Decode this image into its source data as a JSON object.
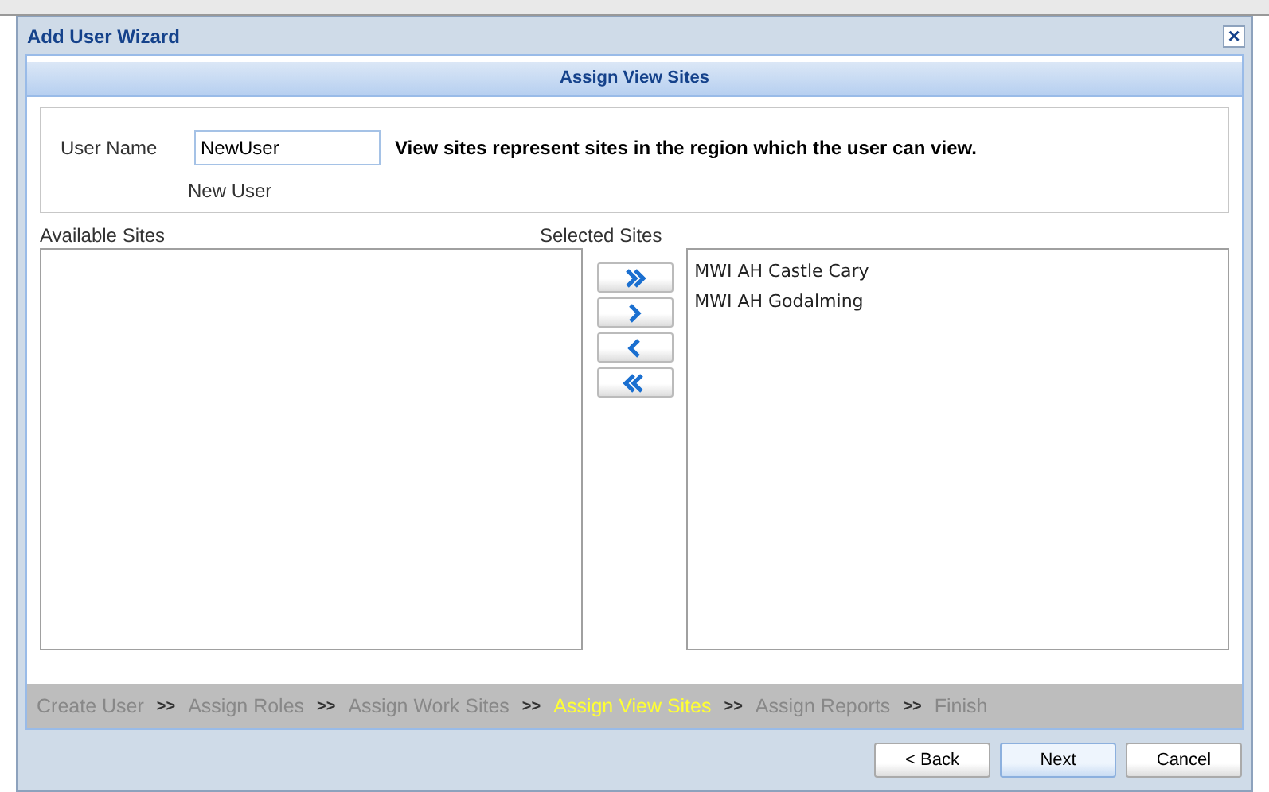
{
  "window": {
    "title": "Add User Wizard",
    "close": "×"
  },
  "header": "Assign View Sites",
  "user": {
    "label": "User Name",
    "value": "NewUser",
    "hint": "View sites represent sites in the region which the user can view.",
    "display_name": "New User"
  },
  "available": {
    "label": "Available Sites"
  },
  "selected_sites": {
    "label": "Selected Sites",
    "items": [
      "MWI AH Castle Cary",
      "MWI AH Godalming"
    ]
  },
  "steps": [
    {
      "label": "Create User",
      "selected": false,
      "separator": ">>"
    },
    {
      "label": "Assign Roles",
      "selected": false,
      "separator": ">>"
    },
    {
      "label": "Assign Work Sites",
      "selected": false,
      "separator": ">>"
    },
    {
      "label": "Assign View Sites",
      "selected": true,
      "separator": ">>"
    },
    {
      "label": "Assign Reports",
      "selected": false,
      "separator": ">>"
    },
    {
      "label": "Finish",
      "selected": false
    }
  ],
  "buttons": [
    {
      "label": "< Back",
      "kind": "normal"
    },
    {
      "label": "Next",
      "kind": "default"
    },
    {
      "label": "Cancel",
      "kind": "normal"
    }
  ]
}
